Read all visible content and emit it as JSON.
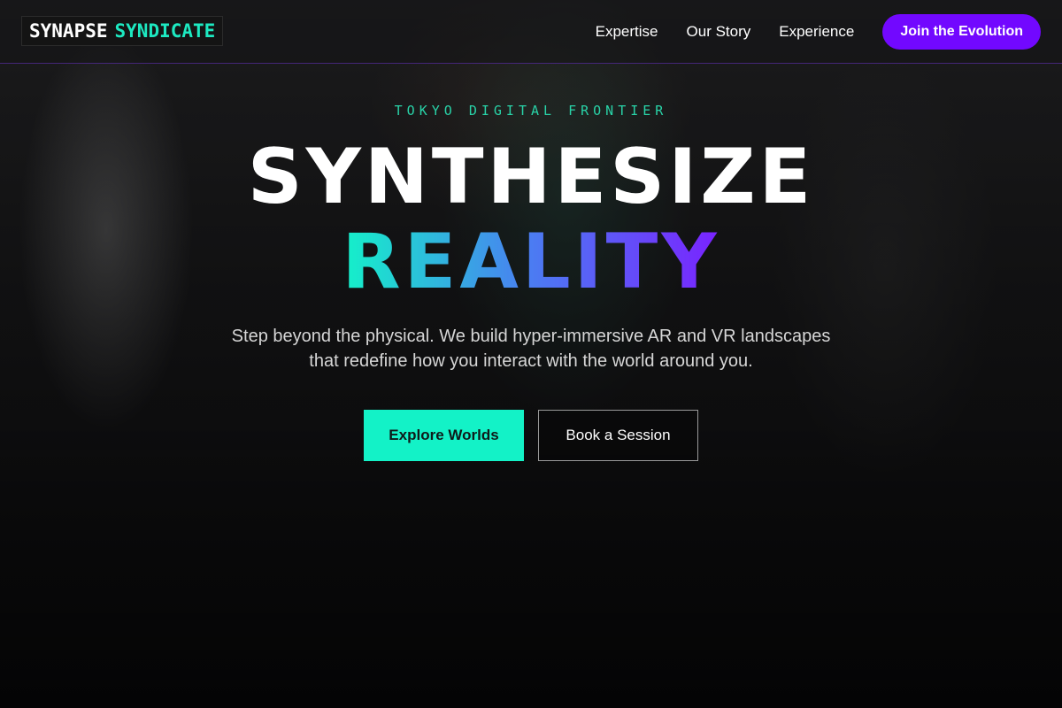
{
  "header": {
    "logo": {
      "word1": "SYNAPSE",
      "word2": "SYNDICATE"
    },
    "nav": [
      {
        "label": "Expertise"
      },
      {
        "label": "Our Story"
      },
      {
        "label": "Experience"
      }
    ],
    "cta_label": "Join the Evolution"
  },
  "hero": {
    "eyebrow": "TOKYO DIGITAL FRONTIER",
    "title_line1": "SYNTHESIZE",
    "title_line2": "REALITY",
    "subtitle": "Step beyond the physical. We build hyper-immersive AR and VR landscapes that redefine how you interact with the world around you.",
    "primary_button": "Explore Worlds",
    "secondary_button": "Book a Session"
  },
  "colors": {
    "accent_teal": "#13f2c7",
    "accent_purple": "#7208ff",
    "eyebrow_green": "#29d3a8"
  }
}
